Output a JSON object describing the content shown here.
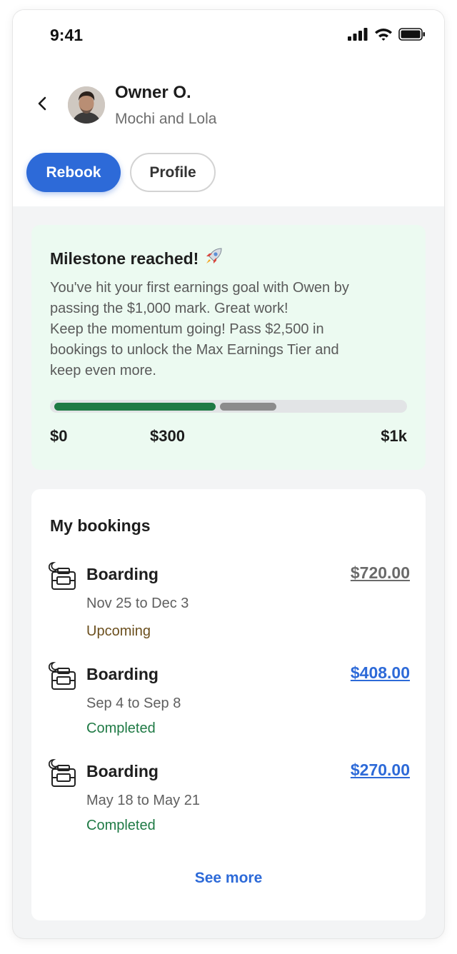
{
  "status_bar": {
    "time": "9:41"
  },
  "header": {
    "owner_name": "Owner O.",
    "pets": "Mochi and Lola",
    "actions": {
      "rebook_label": "Rebook",
      "profile_label": "Profile"
    }
  },
  "milestone": {
    "title": "Milestone reached!",
    "emoji": "🚀",
    "lines": [
      "You've hit your first earnings goal with Owen by",
      "passing the $1,000 mark. Great work!",
      "Keep the momentum going! Pass $2,500 in",
      "bookings to unlock the Max Earnings Tier and",
      "keep even more."
    ],
    "progress_labels": [
      "$0",
      "$300",
      "$1k"
    ],
    "colors": {
      "fill": "#1f7a45",
      "pending": "#8c8c8c",
      "track": "#e2e4e6",
      "background": "#ecfaf1"
    }
  },
  "bookings": {
    "title": "My bookings",
    "items": [
      {
        "icon": "boarding-icon",
        "service": "Boarding",
        "dates": "Nov 25 to Dec 3",
        "status": "Upcoming",
        "amount": "$720.00",
        "status_color": "#6b4f1e",
        "amount_color": "#6a6a6a"
      },
      {
        "icon": "boarding-icon",
        "service": "Boarding",
        "dates": "Sep 4 to Sep 8",
        "status": "Completed",
        "amount": "$408.00",
        "status_color": "#1f7a45",
        "amount_color": "#2d6ad8"
      },
      {
        "icon": "boarding-icon",
        "service": "Boarding",
        "dates": "May 18 to May 21",
        "status": "Completed",
        "amount": "$270.00",
        "status_color": "#1f7a45",
        "amount_color": "#2d6ad8"
      }
    ],
    "see_more_label": "See more"
  },
  "colors": {
    "accent": "#2d6ad8"
  }
}
